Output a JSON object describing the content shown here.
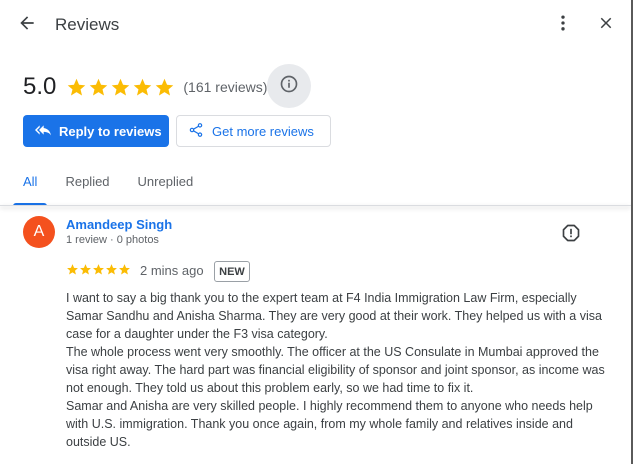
{
  "header": {
    "title": "Reviews"
  },
  "summary": {
    "rating": "5.0",
    "stars": 5,
    "count_text": "(161 reviews)"
  },
  "actions": {
    "reply_label": "Reply to reviews",
    "get_more_label": "Get more reviews"
  },
  "tabs": [
    {
      "label": "All",
      "active": true
    },
    {
      "label": "Replied",
      "active": false
    },
    {
      "label": "Unreplied",
      "active": false
    }
  ],
  "review": {
    "avatar_letter": "A",
    "avatar_color": "#f4511e",
    "name": "Amandeep Singh",
    "meta": "1 review · 0 photos",
    "stars": 5,
    "time": "2 mins ago",
    "badge": "NEW",
    "paragraphs": [
      "I want to say a big thank you to the expert team at F4 India Immigration Law Firm, especially Samar Sandhu and Anisha Sharma. They are very good at their work. They helped us with a visa case for a daughter under the F3 visa category.",
      "The whole process went very smoothly. The officer at the US Consulate in Mumbai approved the visa right away. The hard part was financial eligibility of sponsor and joint sponsor, as income was not enough. They told us about this problem early, so we had time to fix it.",
      "Samar and Anisha are very skilled people. I highly recommend them to anyone who needs help with U.S. immigration. Thank you once again, from my whole family and relatives inside and outside US."
    ]
  },
  "colors": {
    "accent": "#1a73e8",
    "star": "#fbbc04"
  }
}
